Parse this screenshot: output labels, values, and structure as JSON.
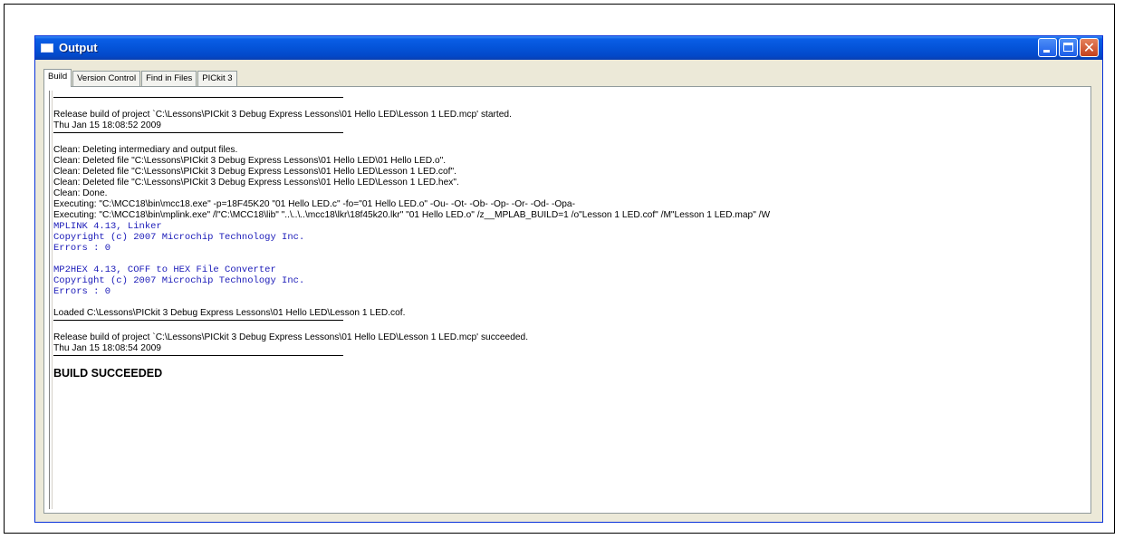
{
  "window": {
    "title": "Output",
    "colors": {
      "titlebar": "#0453d8",
      "close_button": "#c4401c",
      "linker_text": "#1a1ab8"
    }
  },
  "tabs": [
    {
      "label": "Build",
      "active": true
    },
    {
      "label": "Version Control",
      "active": false
    },
    {
      "label": "Find in Files",
      "active": false
    },
    {
      "label": "PICkit 3",
      "active": false
    }
  ],
  "output": {
    "build_started": "Release build of project `C:\\Lessons\\PICkit 3 Debug Express Lessons\\01 Hello LED\\Lesson 1 LED.mcp' started.",
    "start_time": "Thu Jan 15 18:08:52 2009",
    "clean_1": "Clean: Deleting intermediary and output files.",
    "clean_2": "Clean: Deleted file \"C:\\Lessons\\PICkit 3 Debug Express Lessons\\01 Hello LED\\01 Hello LED.o\".",
    "clean_3": "Clean: Deleted file \"C:\\Lessons\\PICkit 3 Debug Express Lessons\\01 Hello LED\\Lesson 1 LED.cof\".",
    "clean_4": "Clean: Deleted file \"C:\\Lessons\\PICkit 3 Debug Express Lessons\\01 Hello LED\\Lesson 1 LED.hex\".",
    "clean_5": "Clean: Done.",
    "exec_1": "Executing: \"C:\\MCC18\\bin\\mcc18.exe\" -p=18F45K20 \"01 Hello LED.c\" -fo=\"01 Hello LED.o\" -Ou- -Ot- -Ob- -Op- -Or- -Od- -Opa-",
    "exec_2": "Executing: \"C:\\MCC18\\bin\\mplink.exe\" /l\"C:\\MCC18\\lib\" \"..\\..\\..\\mcc18\\lkr\\18f45k20.lkr\" \"01 Hello LED.o\" /z__MPLAB_BUILD=1 /o\"Lesson 1 LED.cof\" /M\"Lesson 1 LED.map\" /W",
    "mplink_1": "MPLINK 4.13, Linker",
    "mplink_2": "Copyright (c) 2007 Microchip Technology Inc.",
    "mplink_3": "Errors    : 0",
    "mp2hex_1": "MP2HEX 4.13, COFF to HEX File Converter",
    "mp2hex_2": "Copyright (c) 2007 Microchip Technology Inc.",
    "mp2hex_3": "Errors    : 0",
    "loaded": "Loaded C:\\Lessons\\PICkit 3 Debug Express Lessons\\01 Hello LED\\Lesson 1 LED.cof.",
    "build_succeeded": "Release build of project `C:\\Lessons\\PICkit 3 Debug Express Lessons\\01 Hello LED\\Lesson 1 LED.mcp' succeeded.",
    "end_time": "Thu Jan 15 18:08:54 2009",
    "result": "BUILD SUCCEEDED"
  }
}
